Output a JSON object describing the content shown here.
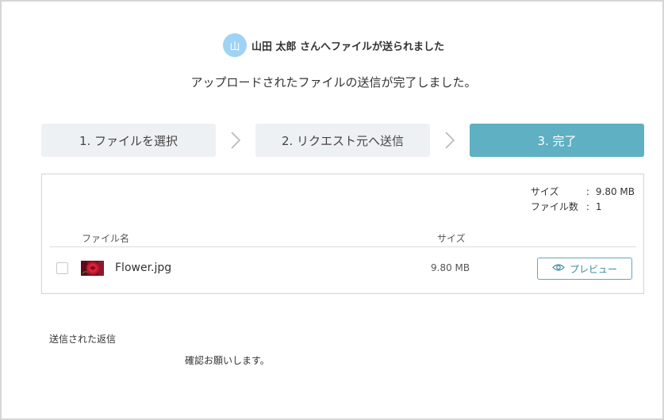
{
  "sender": {
    "avatar_char": "山",
    "text": "山田 太郎 さんへファイルが送られました"
  },
  "headline": "アップロードされたファイルの送信が完了しました。",
  "steps": [
    {
      "label": "1. ファイルを選択",
      "active": false
    },
    {
      "label": "2. リクエスト元へ送信",
      "active": false
    },
    {
      "label": "3. 完了",
      "active": true
    }
  ],
  "summary": {
    "size_label": "サイズ",
    "size_value": "9.80 MB",
    "count_label": "ファイル数",
    "count_value": "1",
    "separator": ":"
  },
  "table": {
    "columns": {
      "name": "ファイル名",
      "size": "サイズ"
    },
    "rows": [
      {
        "name": "Flower.jpg",
        "size": "9.80 MB",
        "checked": false,
        "thumb_icon": "flower-thumbnail"
      }
    ],
    "preview_label": "プレビュー"
  },
  "reply": {
    "label": "送信された返信",
    "text": "確認お願いします。"
  },
  "colors": {
    "accent": "#5fb0c2",
    "step_inactive": "#eef1f4",
    "avatar": "#9fd3f5",
    "preview_border": "#5fa7bb"
  }
}
